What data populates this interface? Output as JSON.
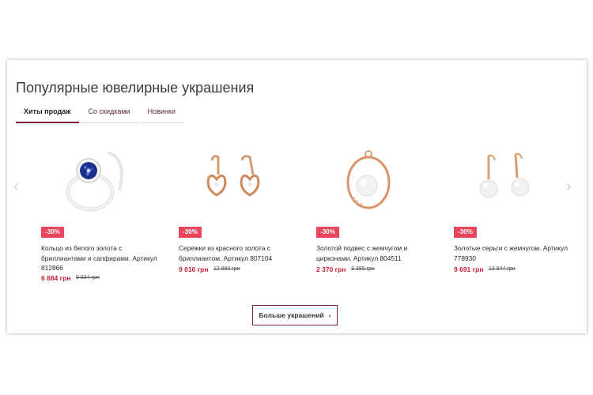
{
  "section": {
    "title": "Популярные ювелирные украшения",
    "tabs": [
      {
        "label": "Хиты продаж"
      },
      {
        "label": "Со скидками"
      },
      {
        "label": "Новинки"
      }
    ],
    "products": [
      {
        "badge": "-30%",
        "name": "Кольцо из белого золота с бриллиантами и сапфирами. Артикул 812866",
        "price": "6 884 грн",
        "old_price": "9 834 грн",
        "image_icon": "ring-icon"
      },
      {
        "badge": "-30%",
        "name": "Сережки из красного золота с бриллиантом. Артикул 807104",
        "price": "9 016 грн",
        "old_price": "12 880 грн",
        "image_icon": "earrings-icon"
      },
      {
        "badge": "-30%",
        "name": "Золотой подвес с жемчугом и цирконами. Артикул 804511",
        "price": "2 370 грн",
        "old_price": "3 385 грн",
        "image_icon": "pendant-icon"
      },
      {
        "badge": "-30%",
        "name": "Золотые серьги с жемчугом. Артикул 778930",
        "price": "9 691 грн",
        "old_price": "13 844 грн",
        "image_icon": "pearl-earrings-icon"
      }
    ],
    "more_button": "Больше украшений"
  },
  "colors": {
    "accent": "#7a1f35",
    "badge": "#e8455e",
    "price": "#c8203a"
  }
}
